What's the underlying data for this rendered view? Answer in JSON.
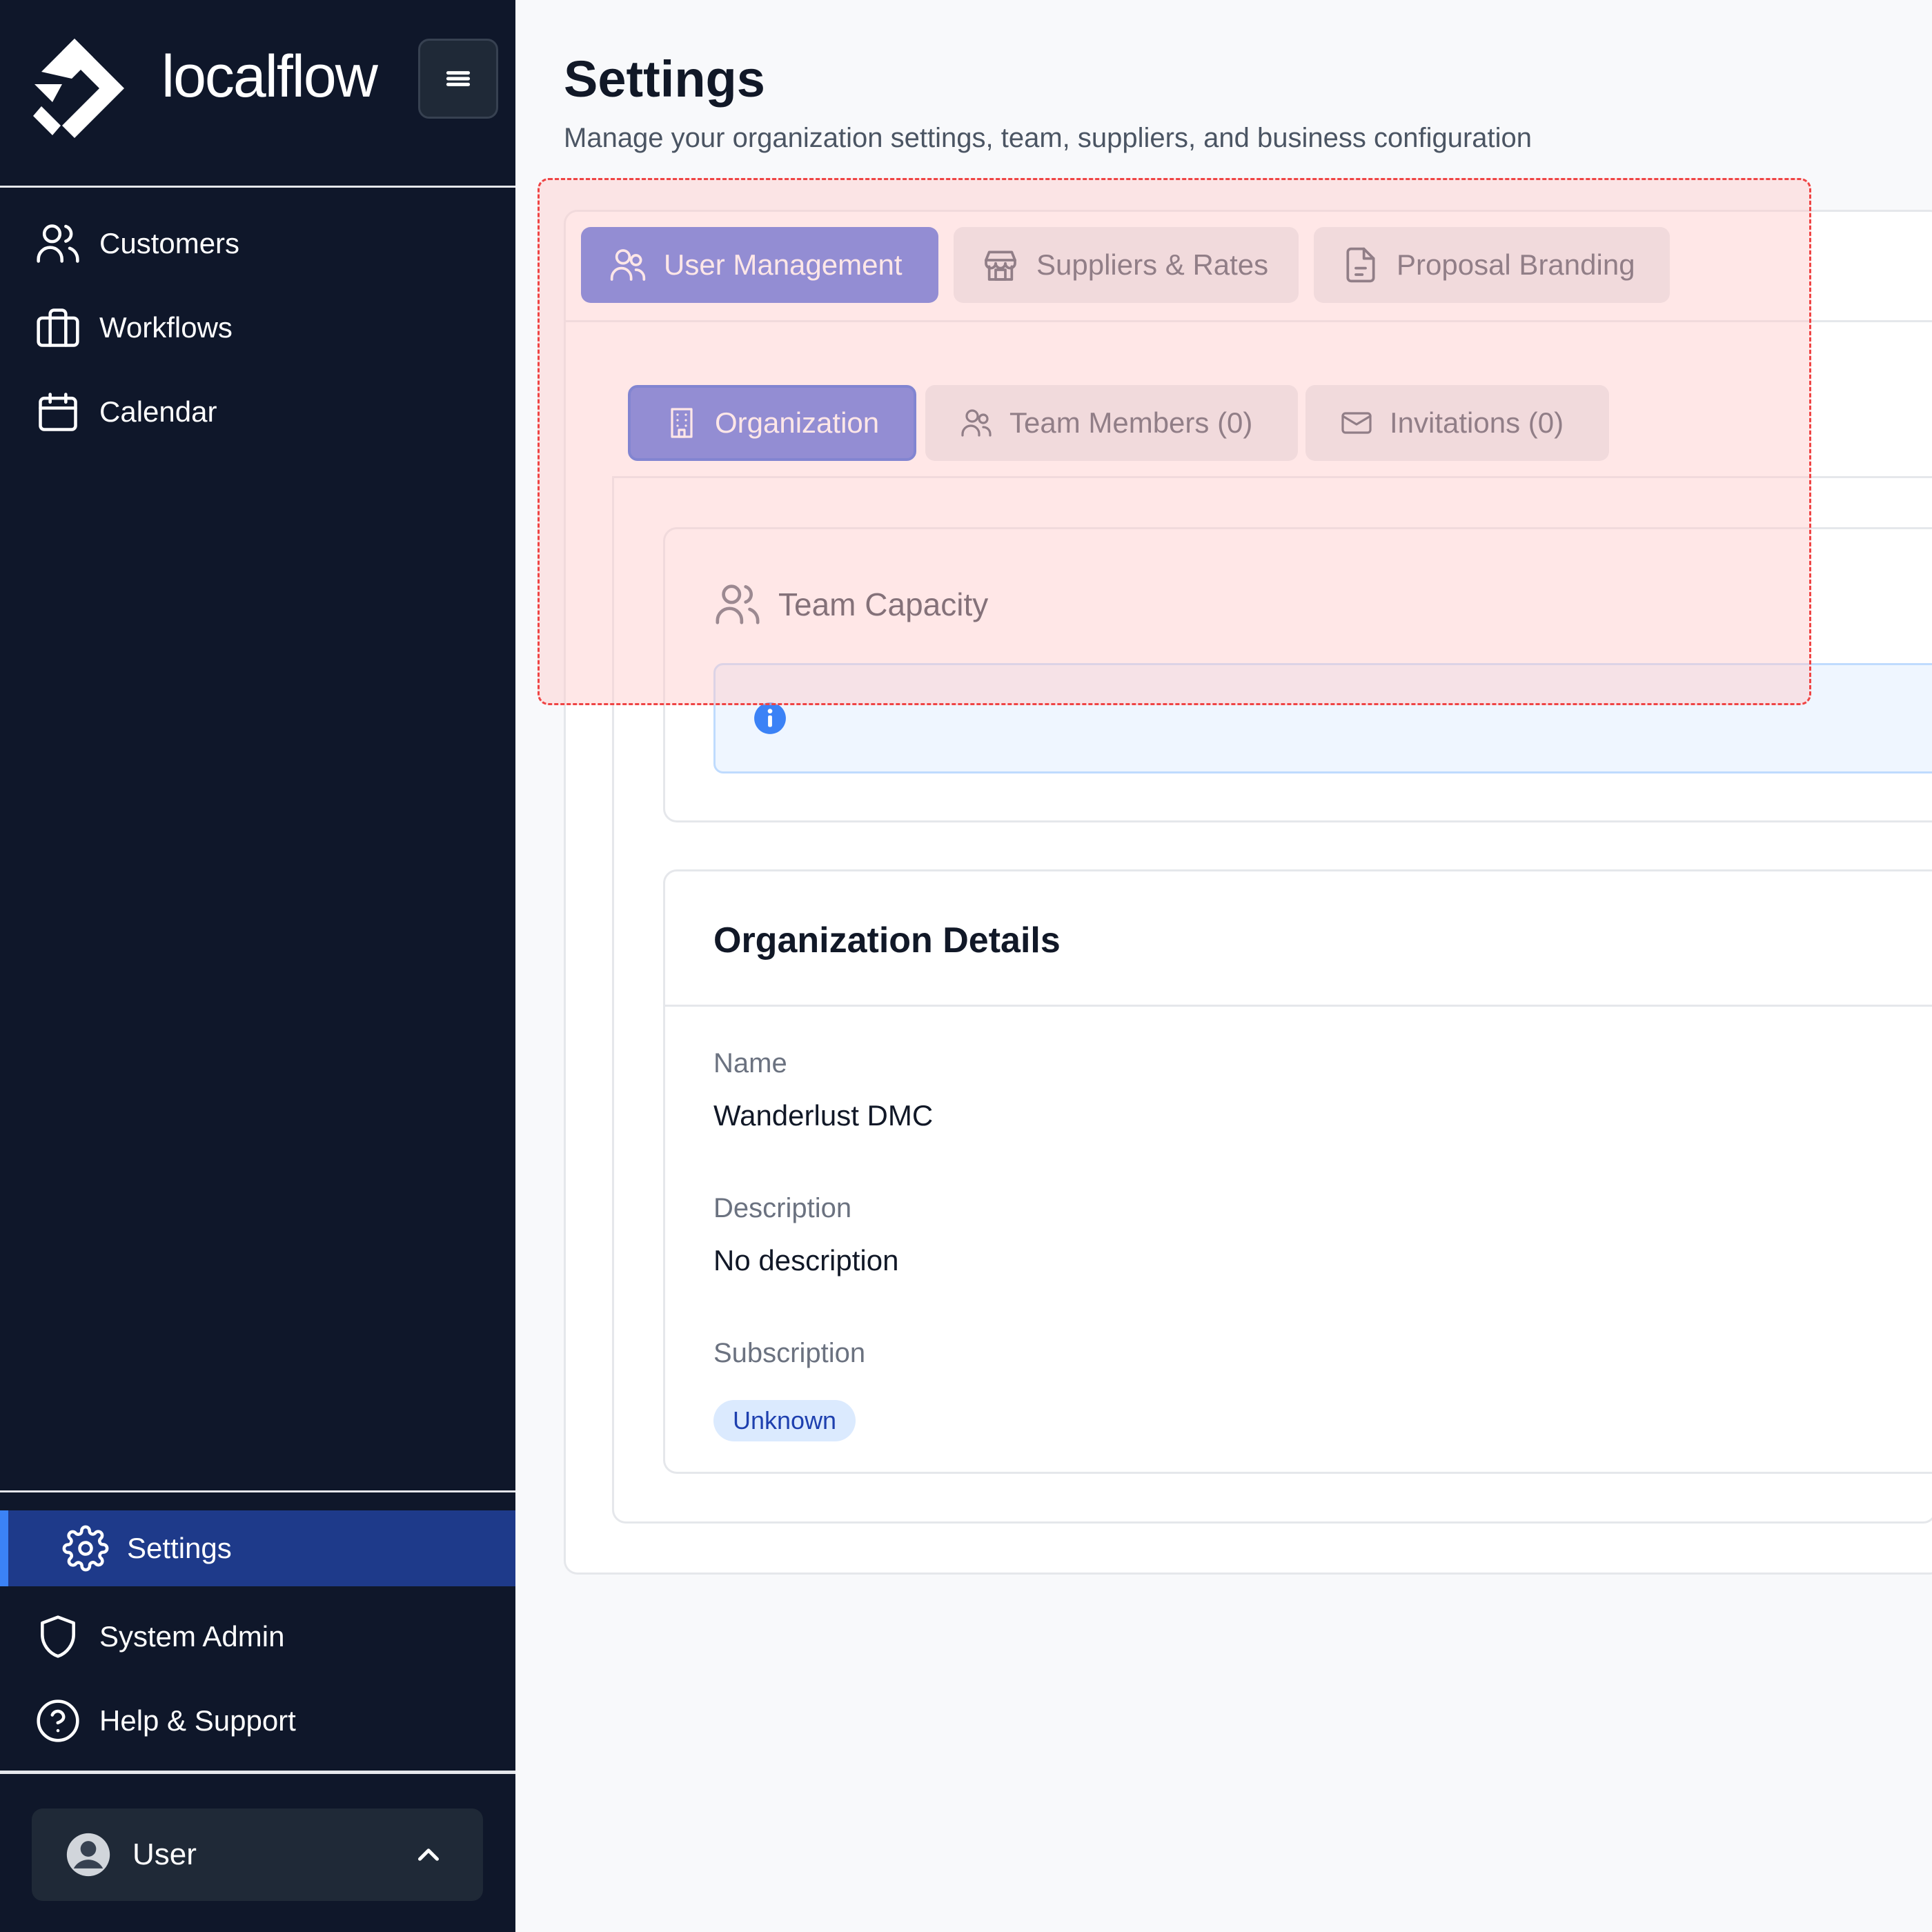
{
  "sidebar": {
    "brand": "localflow",
    "nav": [
      {
        "label": "Customers",
        "icon": "users-icon"
      },
      {
        "label": "Workflows",
        "icon": "briefcase-icon"
      },
      {
        "label": "Calendar",
        "icon": "calendar-icon"
      }
    ],
    "bottom_nav": [
      {
        "label": "Settings",
        "icon": "gear-icon",
        "active": true
      },
      {
        "label": "System Admin",
        "icon": "shield-icon"
      },
      {
        "label": "Help & Support",
        "icon": "help-circle-icon"
      }
    ],
    "user": {
      "label": "User"
    }
  },
  "header": {
    "title": "Settings",
    "subtitle": "Manage your organization settings, team, suppliers, and business configuration"
  },
  "tabs": [
    {
      "label": "User Management",
      "icon": "users-icon",
      "active": true
    },
    {
      "label": "Suppliers & Rates",
      "icon": "store-icon"
    },
    {
      "label": "Proposal Branding",
      "icon": "document-icon"
    }
  ],
  "sub_tabs": [
    {
      "label": "Organization",
      "icon": "building-icon",
      "active": true
    },
    {
      "label": "Team Members (0)",
      "icon": "users-icon"
    },
    {
      "label": "Invitations (0)",
      "icon": "mail-icon"
    }
  ],
  "team_capacity": {
    "title": "Team Capacity"
  },
  "org_details": {
    "title": "Organization Details",
    "fields": [
      {
        "label": "Name",
        "value": "Wanderlust DMC"
      },
      {
        "label": "Description",
        "value": "No description"
      },
      {
        "label": "Subscription",
        "value": "Unknown"
      }
    ]
  },
  "colors": {
    "sidebar_bg": "#0f172a",
    "primary": "#3b5bdb",
    "active_nav": "#1e3a8a",
    "highlight_overlay": "#fecaca"
  }
}
